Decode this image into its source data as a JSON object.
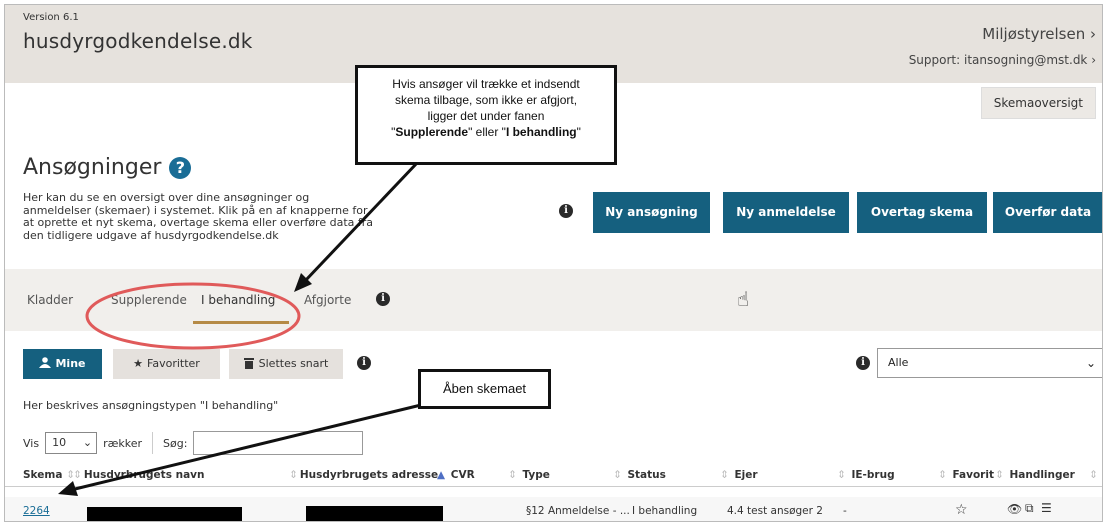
{
  "header": {
    "version": "Version 6.1",
    "brand": "husdyrgodkendelse.dk",
    "agency": "Miljøstyrelsen ›",
    "support": "Support: itansogning@mst.dk ›",
    "overview_button": "Skemaoversigt"
  },
  "page": {
    "title": "Ansøgninger",
    "help_icon_glyph": "?",
    "intro": "Her kan du se en oversigt over dine ansøgninger og anmeldelser (skemaer) i systemet. Klik på en af knapperne for at oprette et nyt skema, overtage skema eller overføre data fra den tidligere udgave af husdyrgodkendelse.dk",
    "info_glyph": "i"
  },
  "actions": {
    "new_application": "Ny ansøgning",
    "new_notification": "Ny anmeldelse",
    "take_over": "Overtag skema",
    "transfer": "Overfør data"
  },
  "tabs": {
    "drafts": "Kladder",
    "supplementary": "Supplerende",
    "in_progress": "I behandling",
    "decided": "Afgjorte",
    "active": "I behandling"
  },
  "filters": {
    "mine": "Mine",
    "favorites": "Favoritter",
    "delete_soon": "Slettes snart",
    "select_value": "Alle"
  },
  "table": {
    "description": "Her beskrives ansøgningstypen \"I behandling\"",
    "show_label": "Vis",
    "page_length": "10",
    "rows_label": "rækker",
    "search_label": "Søg:",
    "columns": [
      "Skema",
      "Husdyrbrugets navn",
      "Husdyrbrugets adresse",
      "CVR",
      "Type",
      "Status",
      "Ejer",
      "IE-brug",
      "Favorit",
      "Handlinger"
    ],
    "rows": [
      {
        "skema": "2264",
        "type": "§12 Anmeldelse - ...",
        "status": "I behandling",
        "ejer": "4.4 test ansøger 2",
        "ie_brug": "-"
      }
    ]
  },
  "callouts": {
    "withdraw_line1": "Hvis ansøger vil trække et indsendt",
    "withdraw_line2": "skema tilbage, som ikke er afgjort,",
    "withdraw_line3": "ligger det under fanen",
    "withdraw_q1": "\"",
    "withdraw_bold1": "Supplerende",
    "withdraw_mid": "\" eller \"",
    "withdraw_bold2": "I behandling",
    "withdraw_q2": "\"",
    "open_schema": "Åben skemaet"
  },
  "icons": {
    "chevron": "❯",
    "user": "user-icon",
    "star": "star-icon",
    "trash": "trash-icon",
    "view": "eye-icon",
    "copy": "copy-icon",
    "list": "list-icon"
  },
  "colors": {
    "primary": "#15607f",
    "header_bg": "#e6e2dd",
    "tab_accent": "#b58a46",
    "highlight_ellipse": "#e05a5a"
  }
}
